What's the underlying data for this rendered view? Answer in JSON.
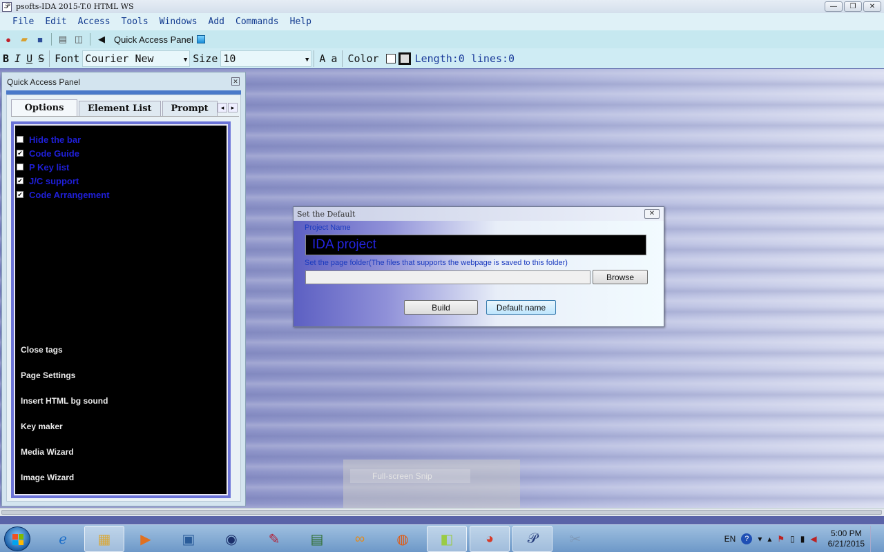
{
  "window": {
    "title": "psofts-IDA 2015-T.0 HTML WS",
    "controls": [
      "—",
      "❐",
      "✕"
    ]
  },
  "menu": [
    "File",
    "Edit",
    "Access",
    "Tools",
    "Windows",
    "Add",
    "Commands",
    "Help"
  ],
  "toolbar": {
    "quick_access_label": "Quick Access Panel"
  },
  "format": {
    "bold": "B",
    "italic": "I",
    "underline": "U",
    "strike": "S",
    "font_label": "Font",
    "font_value": "Courier New",
    "size_label": "Size",
    "size_value": "10",
    "case_upper": "A",
    "case_lower": "a",
    "color_label": "Color",
    "status": "Length:0 lines:0"
  },
  "panel": {
    "title": "Quick Access Panel",
    "tabs": [
      "Options",
      "Element List",
      "Prompt"
    ],
    "options": [
      {
        "label": "Hide the bar",
        "checked": false
      },
      {
        "label": "Code Guide",
        "checked": true
      },
      {
        "label": "P Key list",
        "checked": false
      },
      {
        "label": "J/C support",
        "checked": true
      },
      {
        "label": "Code Arrangement",
        "checked": true
      }
    ],
    "actions": [
      "Close tags",
      "Page Settings",
      "Insert HTML bg sound",
      "Key maker",
      "Media Wizard",
      "Image Wizard"
    ]
  },
  "dialog": {
    "title": "Set the Default",
    "project_label": "Project Name",
    "project_value": "IDA project",
    "folder_label": "Set the page folder(The files that supports the webpage is saved to this folder)",
    "folder_value": "",
    "browse": "Browse",
    "build": "Build",
    "default_name": "Default name"
  },
  "snip": {
    "label": "Full-screen Snip"
  },
  "taskbar": {
    "lang": "EN",
    "time": "5:00 PM",
    "date": "6/21/2015"
  }
}
